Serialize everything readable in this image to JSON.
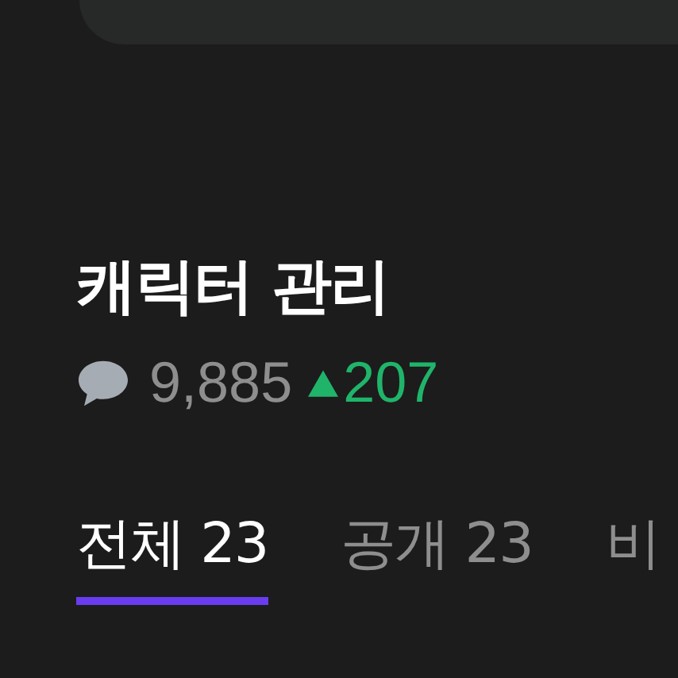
{
  "title": "캐릭터 관리",
  "stats": {
    "comments": "9,885",
    "change": "207",
    "increase": true
  },
  "tabs": [
    {
      "label": "전체 23",
      "selected": true
    },
    {
      "label": "공개 23",
      "selected": false
    },
    {
      "label": "비",
      "selected": false
    }
  ]
}
